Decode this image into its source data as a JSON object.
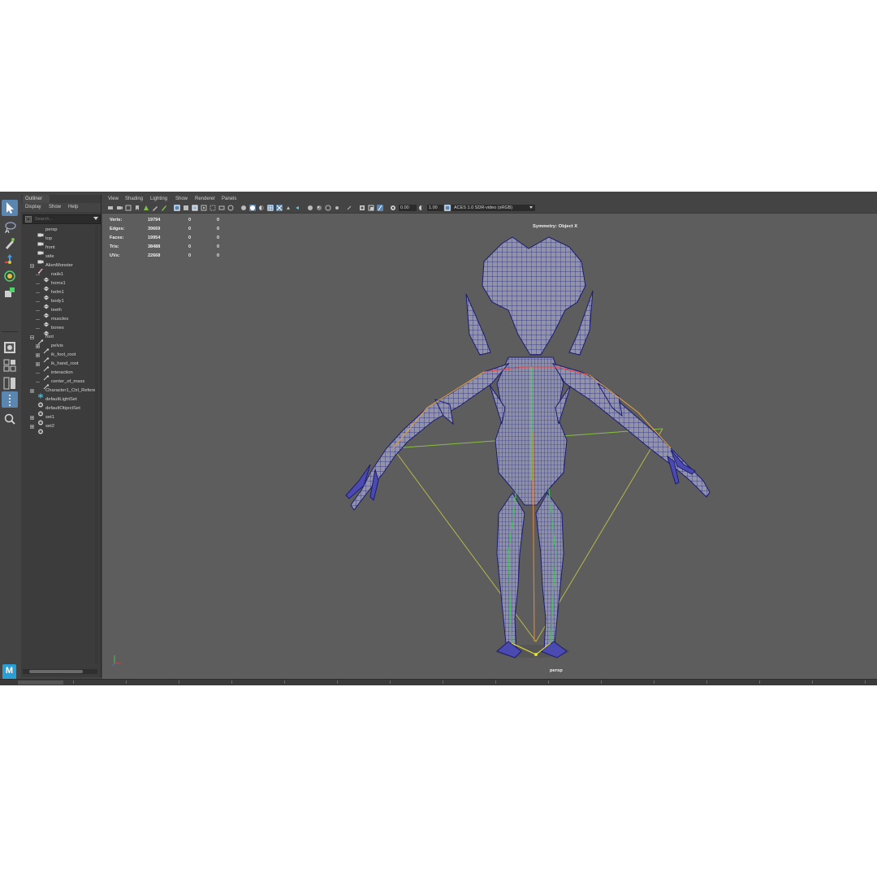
{
  "outliner": {
    "tab": "Outliner",
    "menu": [
      "Display",
      "Show",
      "Help"
    ],
    "search_placeholder": "Search...",
    "items": [
      {
        "label": "persp",
        "icon": "camera-icon"
      },
      {
        "label": "top",
        "icon": "camera-icon"
      },
      {
        "label": "front",
        "icon": "camera-icon"
      },
      {
        "label": "side",
        "icon": "camera-icon"
      },
      {
        "label": "AlienMonster",
        "icon": "group-icon"
      },
      {
        "label": "nails1",
        "icon": "mesh-icon"
      },
      {
        "label": "horns1",
        "icon": "mesh-icon"
      },
      {
        "label": "helm1",
        "icon": "mesh-icon"
      },
      {
        "label": "body1",
        "icon": "mesh-icon"
      },
      {
        "label": "teeth",
        "icon": "mesh-icon"
      },
      {
        "label": "muscles",
        "icon": "mesh-icon"
      },
      {
        "label": "bones",
        "icon": "mesh-icon"
      },
      {
        "label": "root",
        "icon": "joint-icon"
      },
      {
        "label": "pelvis",
        "icon": "joint-icon"
      },
      {
        "label": "ik_foot_root",
        "icon": "joint-icon"
      },
      {
        "label": "ik_hand_root",
        "icon": "joint-icon"
      },
      {
        "label": "interaction",
        "icon": "joint-icon"
      },
      {
        "label": "center_of_mass",
        "icon": "joint-icon"
      },
      {
        "label": "Character1_Ctrl_Refere",
        "icon": "hik-icon"
      },
      {
        "label": "defaultLightSet",
        "icon": "set-icon"
      },
      {
        "label": "defaultObjectSet",
        "icon": "set-icon"
      },
      {
        "label": "set1",
        "icon": "set-icon"
      },
      {
        "label": "set2",
        "icon": "set-icon"
      }
    ]
  },
  "viewport": {
    "menu": [
      "View",
      "Shading",
      "Lighting",
      "Show",
      "Renderer",
      "Panels"
    ],
    "exposure": "0.00",
    "gamma": "1.00",
    "color_management": "ACES 1.0 SDR-video (sRGB)",
    "symmetry": "Symmetry: Object X",
    "camera": "persp",
    "hud": [
      {
        "label": "Verts:",
        "v1": "19794",
        "v2": "0",
        "v3": "0"
      },
      {
        "label": "Edges:",
        "v1": "39669",
        "v2": "0",
        "v3": "0"
      },
      {
        "label": "Faces:",
        "v1": "19954",
        "v2": "0",
        "v3": "0"
      },
      {
        "label": "Tris:",
        "v1": "38488",
        "v2": "0",
        "v3": "0"
      },
      {
        "label": "UVs:",
        "v1": "22668",
        "v2": "0",
        "v3": "0"
      }
    ]
  },
  "logo": "M",
  "colors": {
    "accent": "#5a86b0",
    "viewport_bg": "#5d5d5d",
    "panel_bg": "#444444",
    "mesh_wire": "#3a3ab8",
    "maya_blue": "#2a9fd6"
  }
}
